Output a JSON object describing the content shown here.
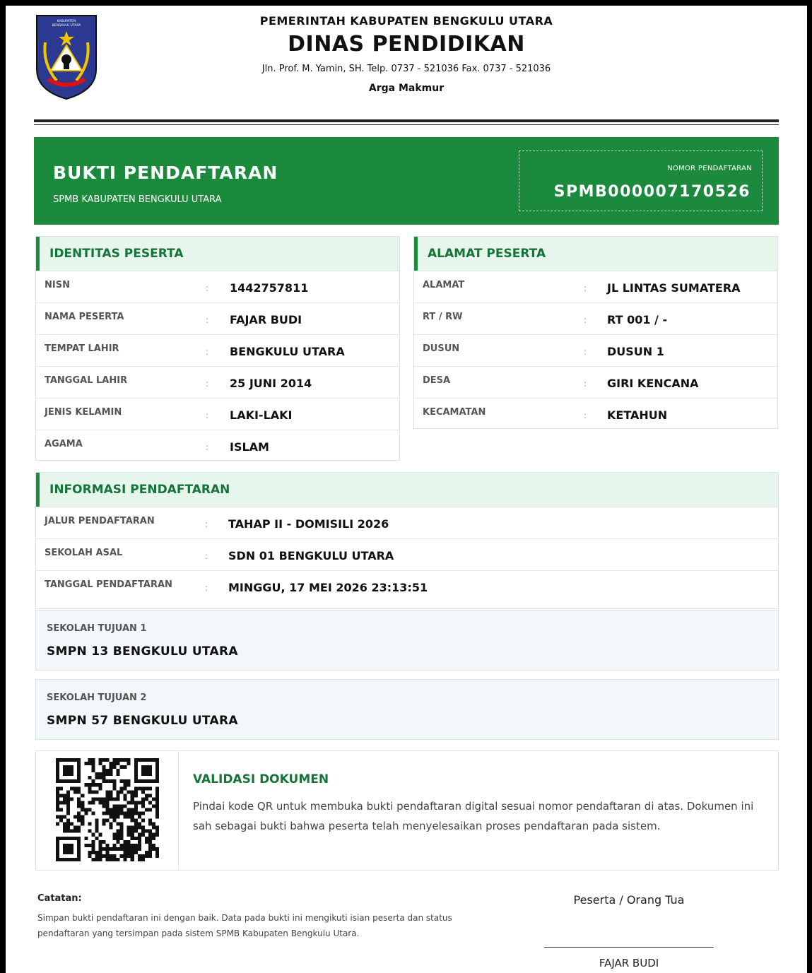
{
  "header": {
    "government": "PEMERINTAH KABUPATEN BENGKULU UTARA",
    "agency": "DINAS PENDIDIKAN",
    "address": "Jln. Prof. M. Yamin, SH. Telp. 0737 - 521036 Fax. 0737 - 521036",
    "city": "Arga Makmur",
    "logo_text": "KABUPATEN BENGKULU UTARA"
  },
  "banner": {
    "title": "BUKTI PENDAFTARAN",
    "subtitle": "SPMB KABUPATEN BENGKULU UTARA",
    "reg_label": "NOMOR PENDAFTARAN",
    "reg_number": "SPMB000007170526"
  },
  "identitas": {
    "title": "IDENTITAS PESERTA",
    "rows": [
      {
        "label": "NISN",
        "value": "1442757811"
      },
      {
        "label": "NAMA PESERTA",
        "value": "FAJAR BUDI"
      },
      {
        "label": "TEMPAT LAHIR",
        "value": "BENGKULU UTARA"
      },
      {
        "label": "TANGGAL LAHIR",
        "value": "25 JUNI 2014"
      },
      {
        "label": "JENIS KELAMIN",
        "value": "LAKI-LAKI"
      },
      {
        "label": "AGAMA",
        "value": "ISLAM"
      }
    ]
  },
  "alamat": {
    "title": "ALAMAT PESERTA",
    "rows": [
      {
        "label": "ALAMAT",
        "value": "JL LINTAS SUMATERA"
      },
      {
        "label": "RT / RW",
        "value": "RT 001 / -"
      },
      {
        "label": "DUSUN",
        "value": "DUSUN 1"
      },
      {
        "label": "DESA",
        "value": "GIRI KENCANA"
      },
      {
        "label": "KECAMATAN",
        "value": "KETAHUN"
      }
    ]
  },
  "informasi": {
    "title": "INFORMASI PENDAFTARAN",
    "rows": [
      {
        "label": "JALUR PENDAFTARAN",
        "value": "TAHAP II - DOMISILI 2026"
      },
      {
        "label": "SEKOLAH ASAL",
        "value": "SDN 01 BENGKULU UTARA"
      },
      {
        "label": "TANGGAL PENDAFTARAN",
        "value": "MINGGU, 17 MEI 2026 23:13:51"
      }
    ]
  },
  "separator": ":",
  "tujuan": [
    {
      "label": "SEKOLAH TUJUAN 1",
      "value": "SMPN 13 BENGKULU UTARA"
    },
    {
      "label": "SEKOLAH TUJUAN 2",
      "value": "SMPN 57 BENGKULU UTARA"
    }
  ],
  "validasi": {
    "title": "VALIDASI DOKUMEN",
    "text": "Pindai kode QR untuk membuka bukti pendaftaran digital sesuai nomor pendaftaran di atas. Dokumen ini sah sebagai bukti bahwa peserta telah menyelesaikan proses pendaftaran pada sistem."
  },
  "catatan": {
    "title": "Catatan:",
    "text": "Simpan bukti pendaftaran ini dengan baik. Data pada bukti ini mengikuti isian peserta dan status pendaftaran yang tersimpan pada sistem SPMB Kabupaten Bengkulu Utara."
  },
  "signature": {
    "role": "Peserta / Orang Tua",
    "name": "FAJAR BUDI"
  },
  "colors": {
    "primary_green": "#1c8a3c",
    "header_green": "#16733a",
    "section_bg": "#e6f6ec",
    "logo_blue": "#2b3990",
    "logo_gold": "#f2c500"
  }
}
